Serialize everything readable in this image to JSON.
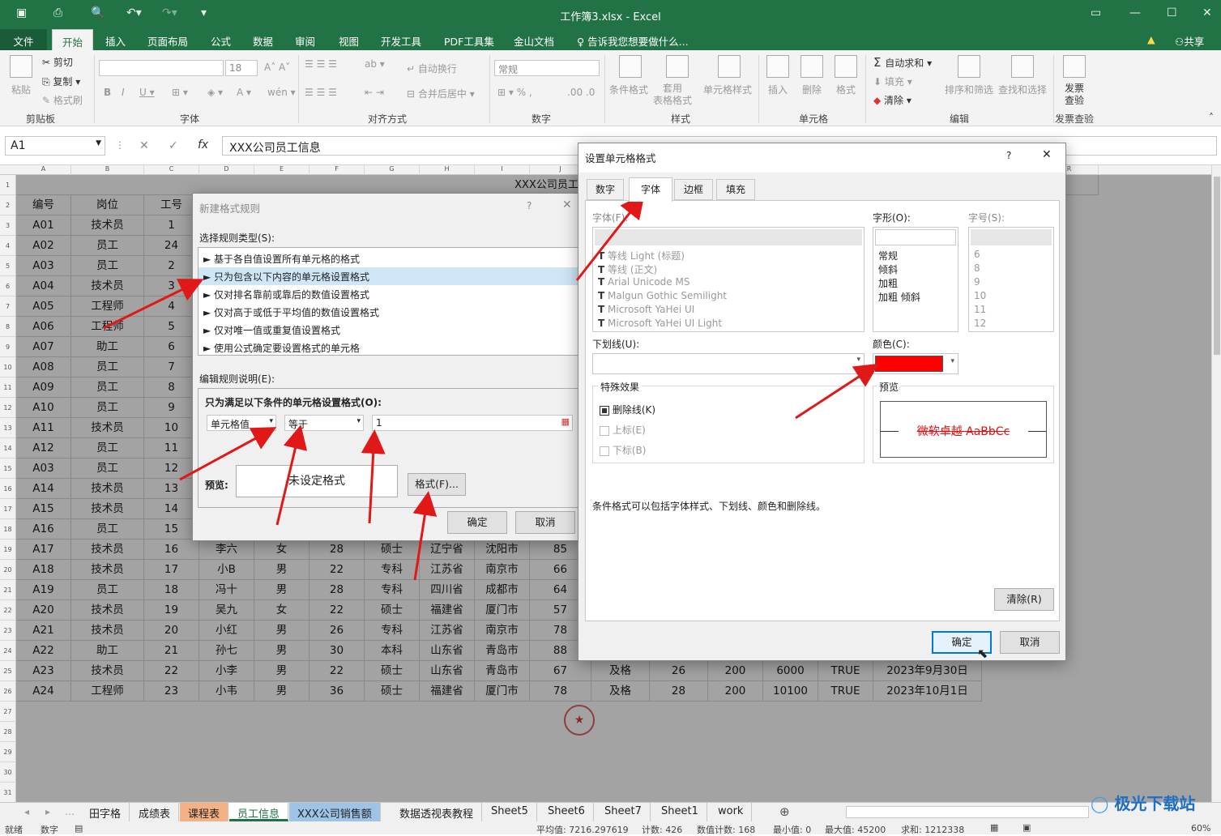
{
  "window": {
    "title": "工作簿3.xlsx - Excel"
  },
  "ribbon_tabs": [
    "文件",
    "开始",
    "插入",
    "页面布局",
    "公式",
    "数据",
    "审阅",
    "视图",
    "开发工具",
    "PDF工具集",
    "金山文档"
  ],
  "tell_me": "告诉我您想要做什么...",
  "share": "共享",
  "ribbon": {
    "paste": "粘贴",
    "cut": "剪切",
    "copy": "复制",
    "format_painter": "格式刷",
    "clipboard": "剪贴板",
    "font_size": "18",
    "font_group": "字体",
    "wrap": "自动换行",
    "merge": "合并后居中",
    "align_group": "对齐方式",
    "number_format": "常规",
    "number_group": "数字",
    "cond_format": "条件格式",
    "table_format": "套用\n表格格式",
    "cell_style": "单元格样式",
    "styles_group": "样式",
    "insert": "插入",
    "delete": "删除",
    "format": "格式",
    "cells_group": "单元格",
    "autosum": "自动求和",
    "fill": "填充",
    "clear": "清除",
    "sort_filter": "排序和筛选",
    "find_select": "查找和选择",
    "edit_group": "编辑",
    "invoice": "发票\n查验",
    "invoice_group": "发票查验"
  },
  "formula_bar": {
    "cell": "A1",
    "fx": "fx",
    "content": "XXX公司员工信息"
  },
  "columns": [
    "A",
    "B",
    "C",
    "D",
    "E",
    "F",
    "G",
    "H",
    "I",
    "J",
    "K",
    "L",
    "M",
    "N",
    "O",
    "P",
    "Q",
    "R"
  ],
  "sheet": {
    "title": "XXX公司员工信息",
    "headers": [
      "编号",
      "岗位",
      "工号"
    ],
    "rows_left": [
      [
        "A01",
        "技术员",
        "1"
      ],
      [
        "A02",
        "员工",
        "24"
      ],
      [
        "A03",
        "员工",
        "2"
      ],
      [
        "A04",
        "技术员",
        "3"
      ],
      [
        "A05",
        "工程师",
        "4"
      ],
      [
        "A06",
        "工程师",
        "5"
      ],
      [
        "A07",
        "助工",
        "6"
      ],
      [
        "A08",
        "员工",
        "7"
      ],
      [
        "A09",
        "员工",
        "8"
      ],
      [
        "A10",
        "员工",
        "9"
      ],
      [
        "A11",
        "技术员",
        "10"
      ],
      [
        "A12",
        "员工",
        "11"
      ],
      [
        "A03",
        "员工",
        "12"
      ],
      [
        "A14",
        "技术员",
        "13"
      ],
      [
        "A15",
        "技术员",
        "14"
      ],
      [
        "A16",
        "员工",
        "15"
      ]
    ],
    "rows_full": [
      [
        "A17",
        "技术员",
        "16",
        "李六",
        "女",
        "28",
        "硕士",
        "辽宁省",
        "沈阳市",
        "85",
        "",
        "",
        "",
        "",
        "",
        ""
      ],
      [
        "A18",
        "技术员",
        "17",
        "小B",
        "男",
        "22",
        "专科",
        "江苏省",
        "南京市",
        "66",
        "",
        "",
        "",
        "",
        "",
        ""
      ],
      [
        "A19",
        "员工",
        "18",
        "冯十",
        "男",
        "28",
        "专科",
        "四川省",
        "成都市",
        "64",
        "",
        "",
        "",
        "",
        "",
        ""
      ],
      [
        "A20",
        "技术员",
        "19",
        "吴九",
        "女",
        "22",
        "硕士",
        "福建省",
        "厦门市",
        "57",
        "",
        "",
        "",
        "",
        "",
        ""
      ],
      [
        "A21",
        "技术员",
        "20",
        "小红",
        "男",
        "26",
        "专科",
        "江苏省",
        "南京市",
        "78",
        "",
        "",
        "",
        "",
        "",
        ""
      ],
      [
        "A22",
        "助工",
        "21",
        "孙七",
        "男",
        "30",
        "本科",
        "山东省",
        "青岛市",
        "88",
        "",
        "",
        "",
        "",
        "",
        ""
      ],
      [
        "A23",
        "技术员",
        "22",
        "小李",
        "男",
        "22",
        "硕士",
        "山东省",
        "青岛市",
        "67",
        "及格",
        "26",
        "200",
        "6000",
        "TRUE",
        "2023年9月30日"
      ],
      [
        "A24",
        "工程师",
        "23",
        "小韦",
        "男",
        "36",
        "硕士",
        "福建省",
        "厦门市",
        "78",
        "及格",
        "28",
        "200",
        "10100",
        "TRUE",
        "2023年10月1日"
      ]
    ]
  },
  "sheet_tabs": [
    "田字格",
    "成绩表",
    "课程表",
    "员工信息",
    "XXX公司销售额",
    "数据透视表教程",
    "Sheet5",
    "Sheet6",
    "Sheet7",
    "Sheet1",
    "work"
  ],
  "active_tab": "员工信息",
  "status": {
    "ready": "就绪",
    "num": "数字",
    "avg": "平均值: 7216.297619",
    "count": "计数: 426",
    "numcount": "数值计数: 168",
    "min": "最小值: 0",
    "max": "最大值: 45200",
    "sum": "求和: 1212338",
    "zoom": "60%"
  },
  "watermark": "极光下载站",
  "rule_dialog": {
    "title": "新建格式规则",
    "help": "?",
    "select_type_label": "选择规则类型(S):",
    "types": [
      "► 基于各自值设置所有单元格的格式",
      "► 只为包含以下内容的单元格设置格式",
      "► 仅对排名靠前或靠后的数值设置格式",
      "► 仅对高于或低于平均值的数值设置格式",
      "► 仅对唯一值或重复值设置格式",
      "► 使用公式确定要设置格式的单元格"
    ],
    "edit_label": "编辑规则说明(E):",
    "condition_label": "只为满足以下条件的单元格设置格式(O):",
    "cond1": "单元格值",
    "cond2": "等于",
    "value": "1",
    "preview_label": "预览:",
    "preview_text": "未设定格式",
    "format_btn": "格式(F)...",
    "ok": "确定",
    "cancel": "取消"
  },
  "format_dialog": {
    "title": "设置单元格格式",
    "help": "?",
    "tabs": [
      "数字",
      "字体",
      "边框",
      "填充"
    ],
    "active_tab": "字体",
    "font_label": "字体(F):",
    "style_label": "字形(O):",
    "size_label": "字号(S):",
    "fonts": [
      "等线 Light (标题)",
      "等线 (正文)",
      "Arial Unicode MS",
      "Malgun Gothic Semilight",
      "Microsoft YaHei UI",
      "Microsoft YaHei UI Light"
    ],
    "styles": [
      "常规",
      "倾斜",
      "加粗",
      "加粗 倾斜"
    ],
    "sizes": [
      "6",
      "8",
      "9",
      "10",
      "11",
      "12"
    ],
    "underline_label": "下划线(U):",
    "color_label": "颜色(C):",
    "color": "#ff0000",
    "effects_label": "特殊效果",
    "strike": "删除线(K)",
    "super": "上标(E)",
    "sub": "下标(B)",
    "preview_label": "预览",
    "preview_text": "微软卓越  AaBbCc",
    "note": "条件格式可以包括字体样式、下划线、颜色和删除线。",
    "clear": "清除(R)",
    "ok": "确定",
    "cancel": "取消"
  }
}
